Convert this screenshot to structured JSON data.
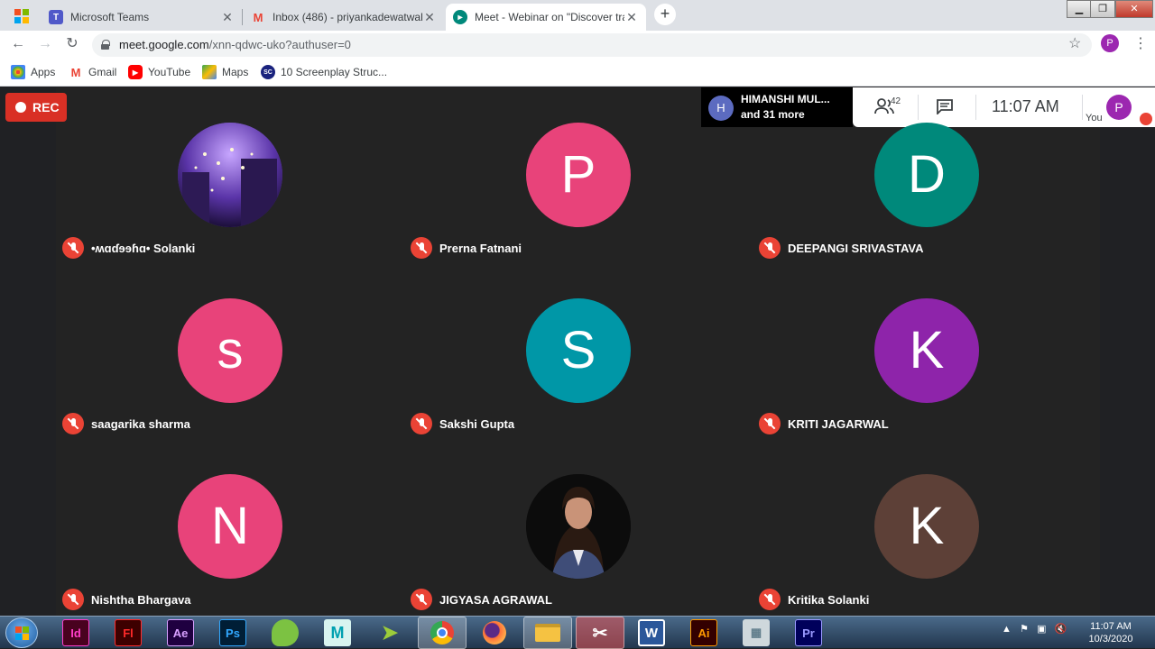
{
  "browser": {
    "tabs": [
      {
        "title": "Microsoft Teams",
        "icon": "teams-icon"
      },
      {
        "title": "Inbox (486) - priyankadewatwal@",
        "icon": "gmail-icon"
      },
      {
        "title": "Meet - Webinar on \"Discover tra",
        "icon": "meet-icon"
      }
    ],
    "url_host": "meet.google.com",
    "url_rest": "/xnn-qdwc-uko?authuser=0",
    "profile_initial": "P",
    "bookmarks": [
      {
        "label": "Apps",
        "icon": "apps-grid-icon"
      },
      {
        "label": "Gmail",
        "icon": "gmail-icon"
      },
      {
        "label": "YouTube",
        "icon": "youtube-icon"
      },
      {
        "label": "Maps",
        "icon": "maps-icon"
      },
      {
        "label": "10 Screenplay Struc...",
        "icon": "sc-icon",
        "icon_text": "SC"
      }
    ]
  },
  "meet": {
    "rec_label": "REC",
    "presenter": {
      "initial": "H",
      "name": "HIMANSHI MUL...",
      "more": "and 31 more"
    },
    "participant_count": "42",
    "time": "11:07  AM",
    "you_label": "You",
    "self_initial": "P",
    "participants": [
      {
        "name": "•ʍɑɗɘɘɦɑ• Solanki",
        "initial": "",
        "color": "#5b3fa8",
        "photo": "city-night"
      },
      {
        "name": "Prerna Fatnani",
        "initial": "P",
        "color": "#e8437a"
      },
      {
        "name": "DEEPANGI SRIVASTAVA",
        "initial": "D",
        "color": "#00897b"
      },
      {
        "name": "saagarika sharma",
        "initial": "s",
        "color": "#e8437a"
      },
      {
        "name": "Sakshi Gupta",
        "initial": "S",
        "color": "#0097a7"
      },
      {
        "name": "KRITI JAGARWAL",
        "initial": "K",
        "color": "#8e24aa"
      },
      {
        "name": "Nishtha Bhargava",
        "initial": "N",
        "color": "#e8437a"
      },
      {
        "name": "JIGYASA AGRAWAL",
        "initial": "",
        "color": "#111111",
        "photo": "portrait"
      },
      {
        "name": "Kritika Solanki",
        "initial": "K",
        "color": "#5d4037"
      }
    ]
  },
  "taskbar": {
    "apps": [
      {
        "label": "Id",
        "color": "#ff3ec9",
        "bg": "#49021f",
        "icon": "indesign-icon"
      },
      {
        "label": "Fl",
        "color": "#ff2a2a",
        "bg": "#3d0000",
        "icon": "flash-icon"
      },
      {
        "label": "Ae",
        "color": "#d8a0ff",
        "bg": "#1f0040",
        "icon": "after-effects-icon"
      },
      {
        "label": "Ps",
        "color": "#31a8ff",
        "bg": "#001e36",
        "icon": "photoshop-icon"
      },
      {
        "label": "",
        "color": "#7cc242",
        "bg": "#2d5a1a",
        "icon": "green-app-icon"
      },
      {
        "label": "M",
        "color": "#00a0b0",
        "bg": "#d8f4f0",
        "icon": "maya-icon"
      },
      {
        "label": "",
        "color": "#9ccc3a",
        "bg": "#4a6a1a",
        "icon": "paper-plane-icon"
      },
      {
        "label": "",
        "color": "#4285f4",
        "bg": "#ffffff",
        "icon": "chrome-icon"
      },
      {
        "label": "",
        "color": "#ff7139",
        "bg": "#5b2a86",
        "icon": "firefox-icon"
      },
      {
        "label": "",
        "color": "#f5c242",
        "bg": "#c89a2a",
        "icon": "folder-icon"
      },
      {
        "label": "",
        "color": "#e53935",
        "bg": "#ffffff",
        "icon": "snipping-tool-icon"
      },
      {
        "label": "W",
        "color": "#ffffff",
        "bg": "#2b579a",
        "icon": "word-icon"
      },
      {
        "label": "Ai",
        "color": "#ff9a00",
        "bg": "#330000",
        "icon": "illustrator-icon"
      },
      {
        "label": "",
        "color": "#607d8b",
        "bg": "#cfd8dc",
        "icon": "calculator-icon"
      },
      {
        "label": "Pr",
        "color": "#9999ff",
        "bg": "#00005b",
        "icon": "premiere-icon"
      }
    ],
    "time": "11:07 AM",
    "date": "10/3/2020"
  }
}
